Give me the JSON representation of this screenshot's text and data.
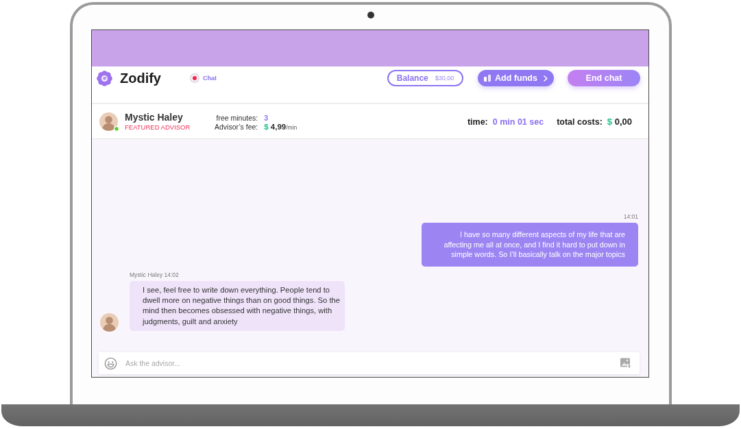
{
  "header": {
    "logo": "Zodify",
    "chat_label": "Chat",
    "balance": {
      "label": "Balance",
      "amount": "$30,00"
    },
    "buttons": [
      {
        "kind": "add_funds",
        "label": "Add funds"
      },
      {
        "kind": "end_chat",
        "label": "End chat"
      }
    ]
  },
  "advisor": {
    "name": "Mystic Haley",
    "badge": "FEATURED ADVISOR",
    "online": true,
    "details": [
      {
        "kind": "count",
        "label": "free minutes:",
        "value": "3"
      },
      {
        "kind": "price",
        "label": "Advisor’s fee:",
        "currency": "$",
        "amount": "4,99",
        "unit": "/min"
      }
    ]
  },
  "session": {
    "time_label": "time:",
    "time": "0 min 01 sec",
    "cost_label": "total costs:",
    "cost_currency": "$",
    "cost": "0,00"
  },
  "messages": [
    {
      "kind": "outgoing",
      "meta": "14:01",
      "text": "I have so many different aspects of my life that are affecting me all at once, and I find it hard to put down in simple words. So I’ll basically talk on the major topics"
    },
    {
      "kind": "incoming",
      "meta": "Mystic Haley 14:02",
      "text": "I see, feel free to write down everything. People tend to dwell more on negative things than on good things. So the mind then becomes obsessed with negative things, with judgments, guilt and anxiety"
    }
  ],
  "composer": {
    "placeholder": "Ask the advisor..."
  }
}
